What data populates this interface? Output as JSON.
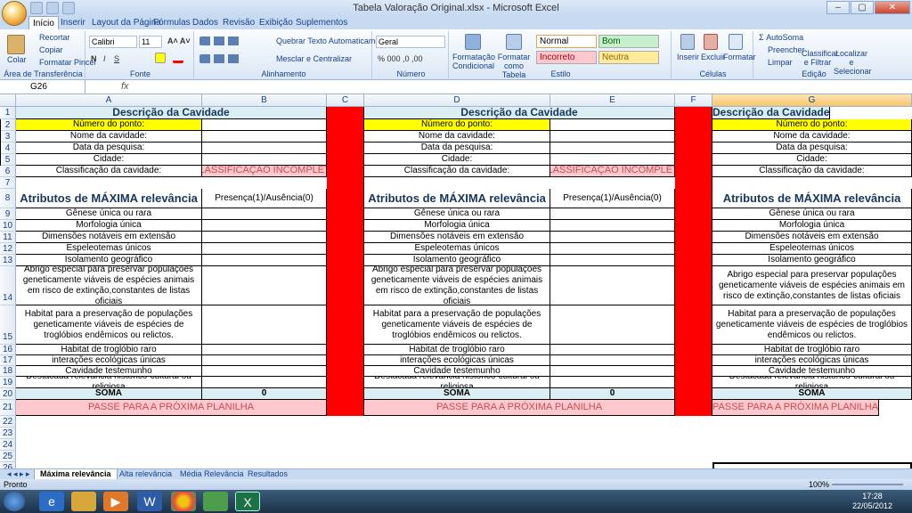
{
  "window": {
    "title": "Tabela Valoração Original.xlsx - Microsoft Excel",
    "controls": [
      "–",
      "▢",
      "✕"
    ]
  },
  "ribbon_tabs": [
    "Início",
    "Inserir",
    "Layout da Página",
    "Fórmulas",
    "Dados",
    "Revisão",
    "Exibição",
    "Suplementos"
  ],
  "ribbon": {
    "clipboard": {
      "paste": "Colar",
      "cut": "Recortar",
      "copy": "Copiar",
      "format_painter": "Formatar Pincel",
      "label": "Área de Transferência"
    },
    "font": {
      "name": "Calibri",
      "size": "11",
      "bold": "N",
      "italic": "I",
      "underline": "S",
      "label": "Fonte"
    },
    "alignment": {
      "wrap": "Quebrar Texto Automaticamente",
      "merge": "Mesclar e Centralizar",
      "label": "Alinhamento"
    },
    "number": {
      "format": "Geral",
      "label": "Número"
    },
    "styles": {
      "cond": "Formatação Condicional",
      "table": "Formatar como Tabela",
      "normal": "Normal",
      "bom": "Bom",
      "incorreto": "Incorreto",
      "neutra": "Neutra",
      "label": "Estilo"
    },
    "cells": {
      "insert": "Inserir",
      "delete": "Excluir",
      "format": "Formatar",
      "label": "Células"
    },
    "editing": {
      "autosum": "AutoSoma",
      "fill": "Preencher",
      "clear": "Limpar",
      "sort": "Classificar e Filtrar",
      "find": "Localizar e Selecionar",
      "label": "Edição"
    }
  },
  "formula_bar": {
    "name_box": "G26",
    "fx": "fx",
    "content": ""
  },
  "columns": [
    "A",
    "B",
    "C",
    "D",
    "E",
    "F",
    "G"
  ],
  "rows": [
    "1",
    "2",
    "3",
    "4",
    "5",
    "6",
    "7",
    "8",
    "9",
    "10",
    "11",
    "12",
    "13",
    "14",
    "15",
    "16",
    "17",
    "18",
    "19",
    "20",
    "21",
    "22",
    "23",
    "24",
    "25",
    "26"
  ],
  "sheet": {
    "descricao": "Descrição da Cavidade",
    "numero": "Número do ponto:",
    "nome": "Nome da cavidade:",
    "data": "Data da pesquisa:",
    "cidade": "Cidade:",
    "classificacao": "Classificação da cavidade:",
    "status": "CLASSIFICAÇÃO INCOMPLETA",
    "atributos": "Atributos de MÁXIMA relevância",
    "presenca": "Presença(1)/Ausência(0)",
    "attrs": [
      "Gênese única ou rara",
      "Morfologia única",
      "Dimensões notáveis em extensão",
      "Espeleotemas únicos",
      "Isolamento geográfico",
      "Abrigo especial para preservar populações geneticamente viáveis de espécies animais em risco de extinção,constantes de listas oficiais",
      "Habitat para a preservação de populações geneticamente viáveis de espécies de troglóbios endêmicos ou relictos.",
      "Habitat de troglóbio raro",
      "interações ecológicas únicas",
      "Cavidade testemunho",
      "Destacada relevância histórico-cultural ou religiosa"
    ],
    "soma": "SOMA",
    "soma_value": "0",
    "passe": "PASSE PARA A PRÓXIMA PLANILHA"
  },
  "sheet_tabs": [
    "Máxima relevância",
    "Alta relevância",
    "Média Relevância",
    "Resultados"
  ],
  "status": {
    "ready": "Pronto",
    "zoom": "100%"
  },
  "clock": {
    "time": "17:28",
    "date": "22/05/2012"
  }
}
